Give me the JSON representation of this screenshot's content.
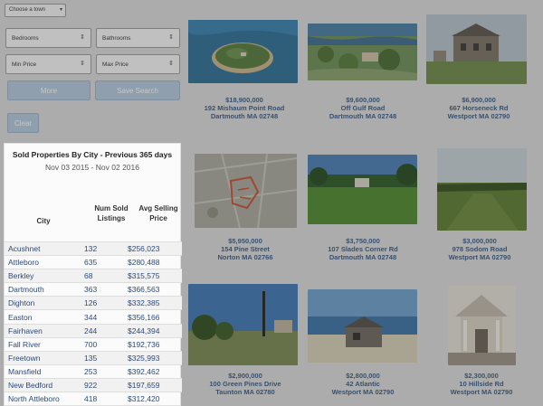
{
  "filters": {
    "town_placeholder": "Choose a town",
    "bedrooms_label": "Bedrooms",
    "bathrooms_label": "Bathrooms",
    "min_price_label": "Min Price",
    "max_price_label": "Max Price",
    "more_label": "More",
    "save_search_label": "Save Search",
    "clear_label": "Clear"
  },
  "stats": {
    "title": "Sold Properties By City - Previous 365 days",
    "date_range": "Nov 03 2015 - Nov 02 2016",
    "headers": {
      "city": "City",
      "num_listings": "Num Sold Listings",
      "avg_price": "Avg Selling Price"
    },
    "rows": [
      {
        "city": "Acushnet",
        "num": "132",
        "avg": "$256,023"
      },
      {
        "city": "Attleboro",
        "num": "635",
        "avg": "$280,488"
      },
      {
        "city": "Berkley",
        "num": "68",
        "avg": "$315,575"
      },
      {
        "city": "Dartmouth",
        "num": "363",
        "avg": "$366,563"
      },
      {
        "city": "Dighton",
        "num": "126",
        "avg": "$332,385"
      },
      {
        "city": "Easton",
        "num": "344",
        "avg": "$356,166"
      },
      {
        "city": "Fairhaven",
        "num": "244",
        "avg": "$244,394"
      },
      {
        "city": "Fall River",
        "num": "700",
        "avg": "$192,736"
      },
      {
        "city": "Freetown",
        "num": "135",
        "avg": "$325,993"
      },
      {
        "city": "Mansfield",
        "num": "253",
        "avg": "$392,462"
      },
      {
        "city": "New Bedford",
        "num": "922",
        "avg": "$197,659"
      },
      {
        "city": "North Attleboro",
        "num": "418",
        "avg": "$312,420"
      }
    ]
  },
  "listings": [
    {
      "price": "$18,900,000",
      "address": "192 Mishaum Point Road",
      "city": "Dartmouth MA 02748",
      "scene": "island-aerial"
    },
    {
      "price": "$9,600,000",
      "address": "Off Gulf Road",
      "city": "Dartmouth MA 02748",
      "scene": "coastal-aerial"
    },
    {
      "price": "$6,900,000",
      "address": "667 Horseneck Rd",
      "city": "Westport MA 02790",
      "scene": "mansion"
    },
    {
      "price": "$5,950,000",
      "address": "154 Pine Street",
      "city": "Norton MA 02766",
      "scene": "plot-map"
    },
    {
      "price": "$3,750,000",
      "address": "107 Slades Corner Rd",
      "city": "Dartmouth MA 02748",
      "scene": "lawn-house"
    },
    {
      "price": "$3,000,000",
      "address": "978 Sodom Road",
      "city": "Westport MA 02790",
      "scene": "field"
    },
    {
      "price": "$2,900,000",
      "address": "100 Green Pines Drive",
      "city": "Taunton MA 02780",
      "scene": "pines"
    },
    {
      "price": "$2,800,000",
      "address": "42 Atlantic",
      "city": "Westport MA 02790",
      "scene": "beach-house"
    },
    {
      "price": "$2,300,000",
      "address": "10 Hillside Rd",
      "city": "Westport MA 02790",
      "scene": "portico"
    }
  ]
}
